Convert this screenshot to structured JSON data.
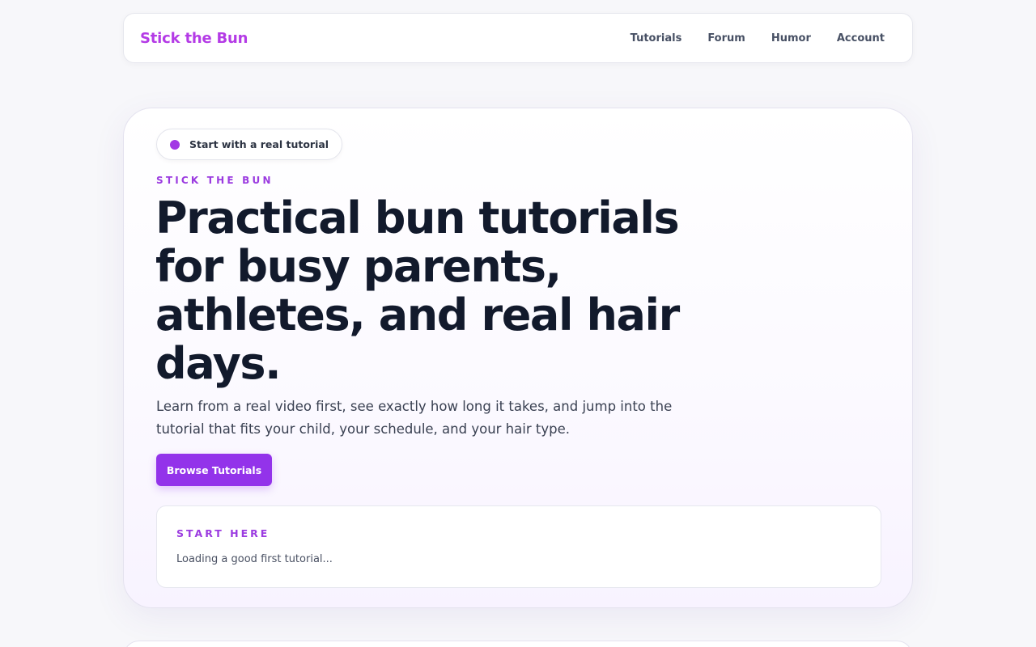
{
  "nav": {
    "brand": "Stick the Bun",
    "links": [
      {
        "label": "Tutorials"
      },
      {
        "label": "Forum"
      },
      {
        "label": "Humor"
      },
      {
        "label": "Account"
      }
    ]
  },
  "hero": {
    "pill_label": "Start with a real tutorial",
    "eyebrow": "STICK THE BUN",
    "headline": "Practical bun tutorials for busy parents, athletes, and real hair days.",
    "lede": "Learn from a real video first, see exactly how long it takes, and jump into the tutorial that fits your child, your schedule, and your hair type.",
    "cta_label": "Browse Tutorials",
    "start_card": {
      "eyebrow": "START HERE",
      "status": "Loading a good first tutorial..."
    }
  },
  "colors": {
    "brand": "#b43be6",
    "accent": "#9333ea",
    "heading": "#121a2c"
  }
}
